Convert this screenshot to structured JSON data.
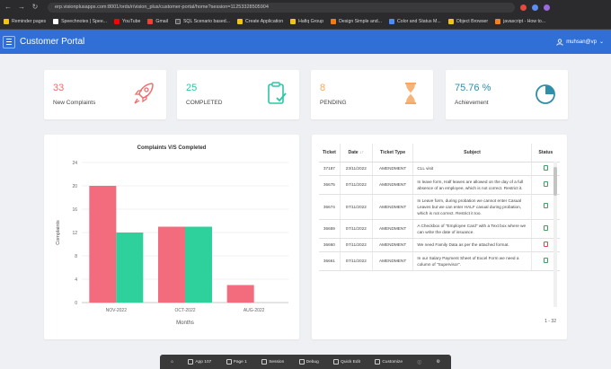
{
  "browser": {
    "url": "erp.visionplusapps.com:8001/ords/r/vision_plus/customer-portal/home?session=11253328505904",
    "bookmarks": [
      {
        "label": "Reminder pages",
        "color": "#f0c419"
      },
      {
        "label": "Speechnotes | Spee...",
        "color": "#ffffff"
      },
      {
        "label": "YouTube",
        "color": "#ff0000"
      },
      {
        "label": "Gmail",
        "color": "#ea4335"
      },
      {
        "label": "SQL Scenario based...",
        "color": "#4a4a4a"
      },
      {
        "label": "Create Application",
        "color": "#f0c419"
      },
      {
        "label": "Hafiq Group",
        "color": "#f0c419"
      },
      {
        "label": "Design Simple and...",
        "color": "#f07b19"
      },
      {
        "label": "Color and Status M...",
        "color": "#4b8df8"
      },
      {
        "label": "Object Browser",
        "color": "#f0c419"
      },
      {
        "label": "javascript - How to...",
        "color": "#f48024"
      }
    ]
  },
  "app": {
    "title": "Customer Portal",
    "user": "muhsan@vp"
  },
  "kpis": [
    {
      "value": "33",
      "label": "New Complaints",
      "color": "#f36c6c",
      "icon": "rocket-icon"
    },
    {
      "value": "25",
      "label": "COMPLETED",
      "color": "#2ec5a6",
      "icon": "clipboard-check-icon"
    },
    {
      "value": "8",
      "label": "PENDING",
      "color": "#f6a760",
      "icon": "hourglass-icon"
    },
    {
      "value": "75.76 %",
      "label": "Achievement",
      "color": "#2f8fa8",
      "icon": "pie-chart-icon"
    }
  ],
  "chart_data": {
    "type": "bar",
    "title": "Complaints V/S Completed",
    "xlabel": "Months",
    "ylabel": "Complaints",
    "categories": [
      "NOV-2022",
      "OCT-2022",
      "AUG-2022"
    ],
    "series": [
      {
        "name": "",
        "color": "#f36c7e",
        "values": [
          20,
          13,
          3
        ]
      },
      {
        "name": "",
        "color": "#2ed19c",
        "values": [
          12,
          13,
          0
        ]
      }
    ],
    "ylim": [
      0,
      24
    ],
    "yticks": [
      0,
      4,
      8,
      12,
      16,
      20,
      24
    ],
    "grid": true
  },
  "table": {
    "columns": [
      "Ticket",
      "Date",
      "Ticket Type",
      "Subject",
      "Status"
    ],
    "rows": [
      {
        "ticket": "37187",
        "date": "23/11/2022",
        "type": "AMENDMENT",
        "subject": "CLL visit",
        "status": "green"
      },
      {
        "ticket": "36675",
        "date": "07/11/2022",
        "type": "AMENDMENT",
        "subject": "In leave form, Half leaves are allowed on the day of a full absence of an employee, which is not correct. Restrict it.",
        "status": "green"
      },
      {
        "ticket": "36674",
        "date": "07/11/2022",
        "type": "AMENDMENT",
        "subject": "In Leave form, during probation we cannot enter Casual Leaves but we can enter HALF casual during probation, which is not correct. Restrict it too.",
        "status": "green"
      },
      {
        "ticket": "36659",
        "date": "07/11/2022",
        "type": "AMENDMENT",
        "subject": "A Checkbox of \"Employee Card\" with a Text box where we can write the date of issuance.",
        "status": "green"
      },
      {
        "ticket": "36660",
        "date": "07/11/2022",
        "type": "AMENDMENT",
        "subject": "We need Family Data as per the attached format.",
        "status": "red"
      },
      {
        "ticket": "36661",
        "date": "07/11/2022",
        "type": "AMENDMENT",
        "subject": "In our Salary Payment Sheet of Excel Form we need a column of \"Supervisor\".",
        "status": "green"
      }
    ],
    "pagination": "1 - 32"
  },
  "devbar": {
    "items": [
      "App 107",
      "Page 1",
      "Session",
      "Debug",
      "Quick Edit",
      "Customize"
    ]
  }
}
